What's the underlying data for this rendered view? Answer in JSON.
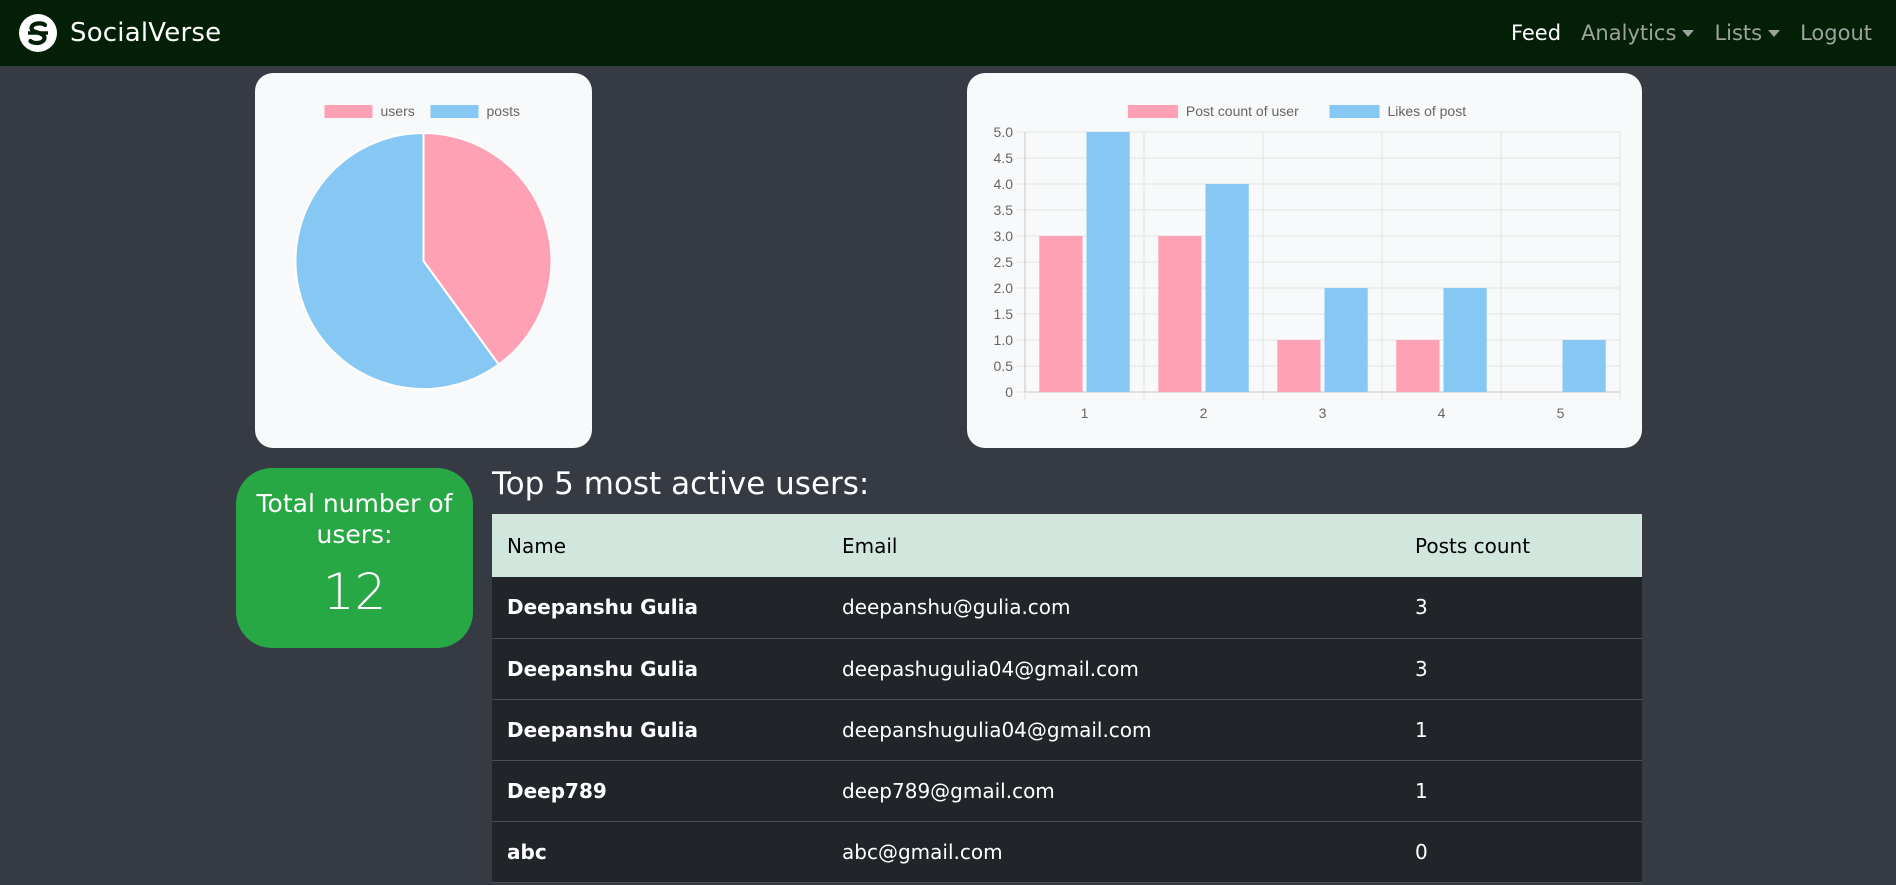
{
  "navbar": {
    "brand": "SocialVerse",
    "links": {
      "feed": "Feed",
      "analytics": "Analytics",
      "lists": "Lists",
      "logout": "Logout"
    }
  },
  "chart_data": [
    {
      "type": "pie",
      "labels": [
        "users",
        "posts"
      ],
      "values": [
        12,
        18
      ],
      "colors": [
        "#ffa1b5",
        "#86c7f3"
      ],
      "legend": "top"
    },
    {
      "type": "bar",
      "categories": [
        "1",
        "2",
        "3",
        "4",
        "5"
      ],
      "series": [
        {
          "name": "Post count of user",
          "values": [
            3,
            3,
            1,
            1,
            0
          ],
          "color": "#ffa1b5"
        },
        {
          "name": "Likes of post",
          "values": [
            5,
            4,
            2,
            2,
            1
          ],
          "color": "#86c7f3"
        }
      ],
      "ylim": [
        0,
        5
      ],
      "yticks": [
        "0",
        "0.5",
        "1.0",
        "1.5",
        "2.0",
        "2.5",
        "3.0",
        "3.5",
        "4.0",
        "4.5",
        "5.0"
      ],
      "grid": true,
      "legend": "top"
    }
  ],
  "stats": {
    "total_users_label": "Total number of users:",
    "total_users_value": "12"
  },
  "top_users": {
    "title": "Top 5 most active users:",
    "columns": [
      "Name",
      "Email",
      "Posts count"
    ],
    "rows": [
      {
        "name": "Deepanshu Gulia",
        "email": "deepanshu@gulia.com",
        "posts": "3"
      },
      {
        "name": "Deepanshu Gulia",
        "email": "deepashugulia04@gmail.com",
        "posts": "3"
      },
      {
        "name": "Deepanshu Gulia",
        "email": "deepanshugulia04@gmail.com",
        "posts": "1"
      },
      {
        "name": "Deep789",
        "email": "deep789@gmail.com",
        "posts": "1"
      },
      {
        "name": "abc",
        "email": "abc@gmail.com",
        "posts": "0"
      }
    ]
  }
}
